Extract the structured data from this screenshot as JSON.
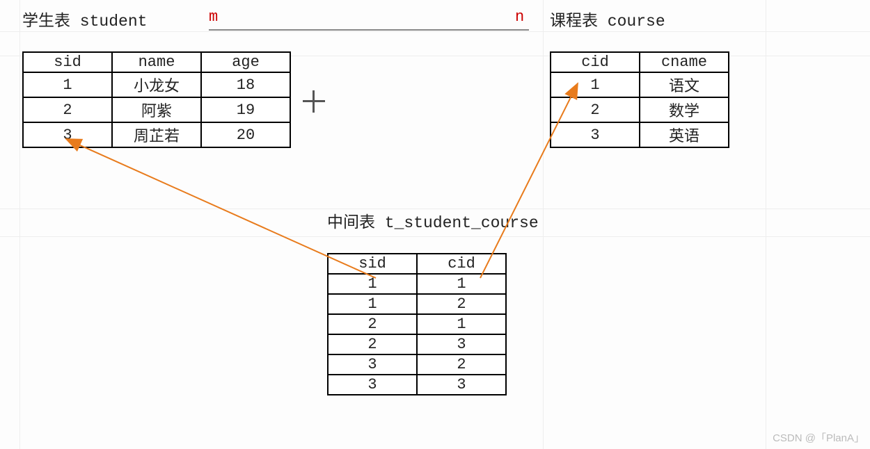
{
  "relation": {
    "left_cardinality": "m",
    "right_cardinality": "n"
  },
  "student": {
    "title": "学生表  student",
    "columns": [
      "sid",
      "name",
      "age"
    ],
    "rows": [
      [
        "1",
        "小龙女",
        "18"
      ],
      [
        "2",
        "阿紫",
        "19"
      ],
      [
        "3",
        "周芷若",
        "20"
      ]
    ]
  },
  "course": {
    "title": "课程表 course",
    "columns": [
      "cid",
      "cname"
    ],
    "rows": [
      [
        "1",
        "语文"
      ],
      [
        "2",
        "数学"
      ],
      [
        "3",
        "英语"
      ]
    ]
  },
  "linktable": {
    "title": "中间表 t_student_course",
    "columns": [
      "sid",
      "cid"
    ],
    "rows": [
      [
        "1",
        "1"
      ],
      [
        "1",
        "2"
      ],
      [
        "2",
        "1"
      ],
      [
        "2",
        "3"
      ],
      [
        "3",
        "2"
      ],
      [
        "3",
        "3"
      ]
    ]
  },
  "watermark": "CSDN @「PlanA」",
  "chart_data": {
    "type": "table",
    "description": "Entity-relationship diagram: student table (sid,name,age) ↔ link table t_student_course (sid,cid) ↔ course table (cid,cname), many-to-many (m:n)",
    "tables": {
      "student": {
        "columns": [
          "sid",
          "name",
          "age"
        ],
        "rows": [
          [
            1,
            "小龙女",
            18
          ],
          [
            2,
            "阿紫",
            19
          ],
          [
            3,
            "周芷若",
            20
          ]
        ]
      },
      "course": {
        "columns": [
          "cid",
          "cname"
        ],
        "rows": [
          [
            1,
            "语文"
          ],
          [
            2,
            "数学"
          ],
          [
            3,
            "英语"
          ]
        ]
      },
      "t_student_course": {
        "columns": [
          "sid",
          "cid"
        ],
        "rows": [
          [
            1,
            1
          ],
          [
            1,
            2
          ],
          [
            2,
            1
          ],
          [
            2,
            3
          ],
          [
            3,
            2
          ],
          [
            3,
            3
          ]
        ]
      }
    },
    "relationships": [
      {
        "from": "t_student_course.sid",
        "to": "student.sid"
      },
      {
        "from": "t_student_course.cid",
        "to": "course.cid"
      }
    ],
    "cardinality": {
      "student": "m",
      "course": "n"
    }
  }
}
